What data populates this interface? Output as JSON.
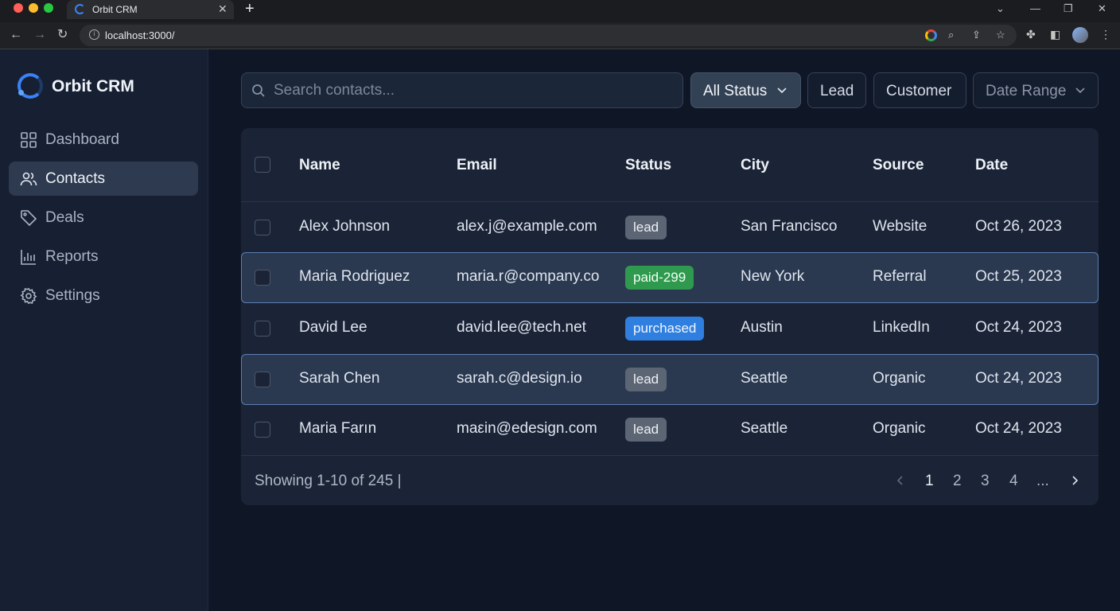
{
  "browser": {
    "tab_title": "Orbit CRM",
    "url": "localhost:3000/"
  },
  "sidebar": {
    "brand": "Orbit CRM",
    "items": [
      {
        "label": "Dashboard",
        "icon": "dashboard-icon"
      },
      {
        "label": "Contacts",
        "icon": "users-icon",
        "active": true
      },
      {
        "label": "Deals",
        "icon": "tag-icon"
      },
      {
        "label": "Reports",
        "icon": "bar-chart-icon"
      },
      {
        "label": "Settings",
        "icon": "gear-icon"
      }
    ]
  },
  "toolbar": {
    "search_placeholder": "Search contacts...",
    "status_filter": "All Status",
    "lead_filter": "Lead",
    "customer_filter": "Customer",
    "date_filter": "Date Range"
  },
  "table": {
    "columns": [
      "Name",
      "Email",
      "Status",
      "City",
      "Source",
      "Date"
    ],
    "rows": [
      {
        "name": "Alex Johnson",
        "email": "alex.j@example.com",
        "status": "lead",
        "status_color": "#5c6574",
        "city": "San Francisco",
        "source": "Website",
        "date": "Oct 26, 2023"
      },
      {
        "name": "Maria Rodriguez",
        "email": "maria.r@company.co",
        "status": "paid-299",
        "status_color": "#2f9a4e",
        "city": "New York",
        "source": "Referral",
        "date": "Oct 25, 2023"
      },
      {
        "name": "David Lee",
        "email": "david.lee@tech.net",
        "status": "purchased",
        "status_color": "#2f7fe0",
        "city": "Austin",
        "source": "LinkedIn",
        "date": "Oct 24, 2023"
      },
      {
        "name": "Sarah Chen",
        "email": "sarah.c@design.io",
        "status": "lead",
        "status_color": "#5c6574",
        "city": "Seattle",
        "source": "Organic",
        "date": "Oct 24, 2023"
      },
      {
        "name": "Maria Farın",
        "email": "maεin@edesign.com",
        "status": "lead",
        "status_color": "#5c6574",
        "city": "Seattle",
        "source": "Organic",
        "date": "Oct 24, 2023"
      }
    ]
  },
  "footer": {
    "showing": "Showing 1-10 of 245 |",
    "pages": [
      "1",
      "2",
      "3",
      "4",
      "..."
    ],
    "current_page": "1"
  },
  "colors": {
    "accent": "#3b82f6",
    "background": "#0f1626",
    "sidebar": "#172033",
    "row_highlight": "#2a3850"
  }
}
